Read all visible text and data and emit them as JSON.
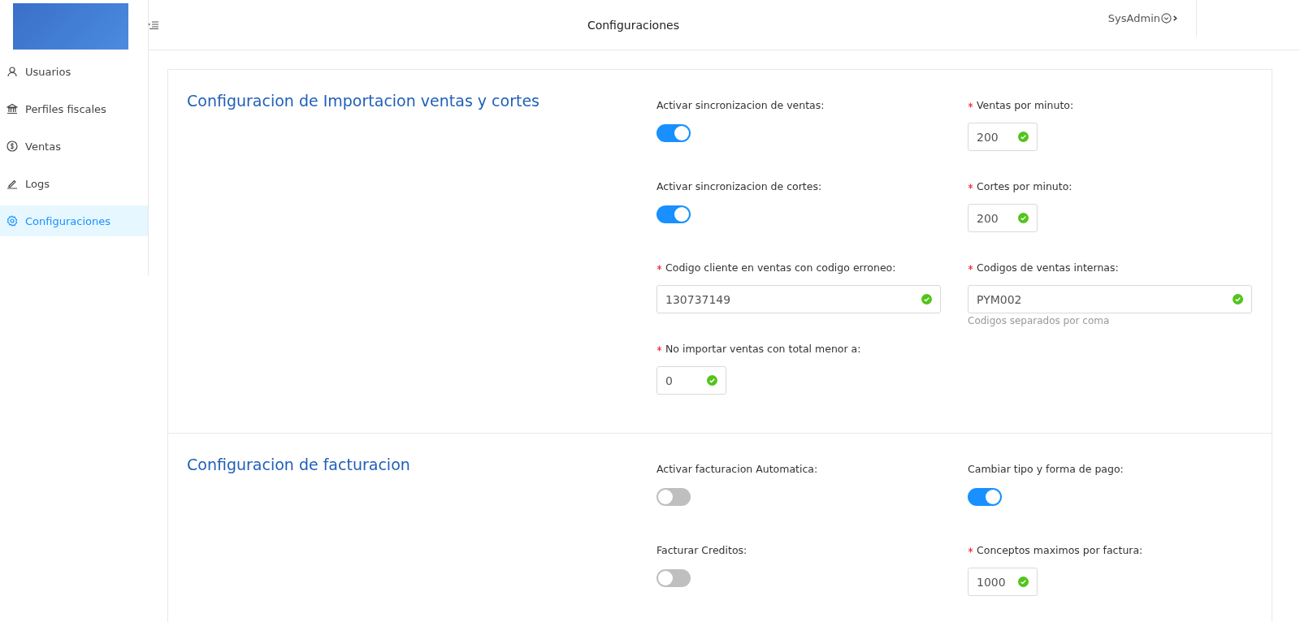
{
  "sidebar": {
    "items": [
      {
        "label": "Usuarios",
        "selected": false
      },
      {
        "label": "Perfiles fiscales",
        "selected": false
      },
      {
        "label": "Ventas",
        "selected": false
      },
      {
        "label": "Logs",
        "selected": false
      },
      {
        "label": "Configuraciones",
        "selected": true
      }
    ]
  },
  "header": {
    "title": "Configuraciones",
    "user": "SysAdmin"
  },
  "sections": [
    {
      "title": "Configuracion de Importacion ventas y cortes",
      "fields": [
        {
          "kind": "switch",
          "label": "Activar sincronizacion de ventas:",
          "required": false,
          "on": true
        },
        {
          "kind": "number",
          "label": "Ventas por minuto:",
          "required": true,
          "value": "200"
        },
        {
          "kind": "switch",
          "label": "Activar sincronizacion de cortes:",
          "required": false,
          "on": true
        },
        {
          "kind": "number",
          "label": "Cortes por minuto:",
          "required": true,
          "value": "200"
        },
        {
          "kind": "text",
          "label": "Codigo cliente en ventas con codigo erroneo:",
          "required": true,
          "value": "130737149"
        },
        {
          "kind": "text",
          "label": "Codigos de ventas internas:",
          "required": true,
          "value": "PYM002",
          "hint": "Codigos separados por coma"
        },
        {
          "kind": "number",
          "label": "No importar ventas con total menor a:",
          "required": true,
          "value": "0"
        }
      ]
    },
    {
      "title": "Configuracion de facturacion",
      "fields": [
        {
          "kind": "switch",
          "label": "Activar facturacion Automatica:",
          "required": false,
          "on": false
        },
        {
          "kind": "switch",
          "label": "Cambiar tipo y forma de pago:",
          "required": false,
          "on": true
        },
        {
          "kind": "switch",
          "label": "Facturar Creditos:",
          "required": false,
          "on": false
        },
        {
          "kind": "number",
          "label": "Conceptos maximos por factura:",
          "required": true,
          "value": "1000"
        }
      ]
    }
  ]
}
